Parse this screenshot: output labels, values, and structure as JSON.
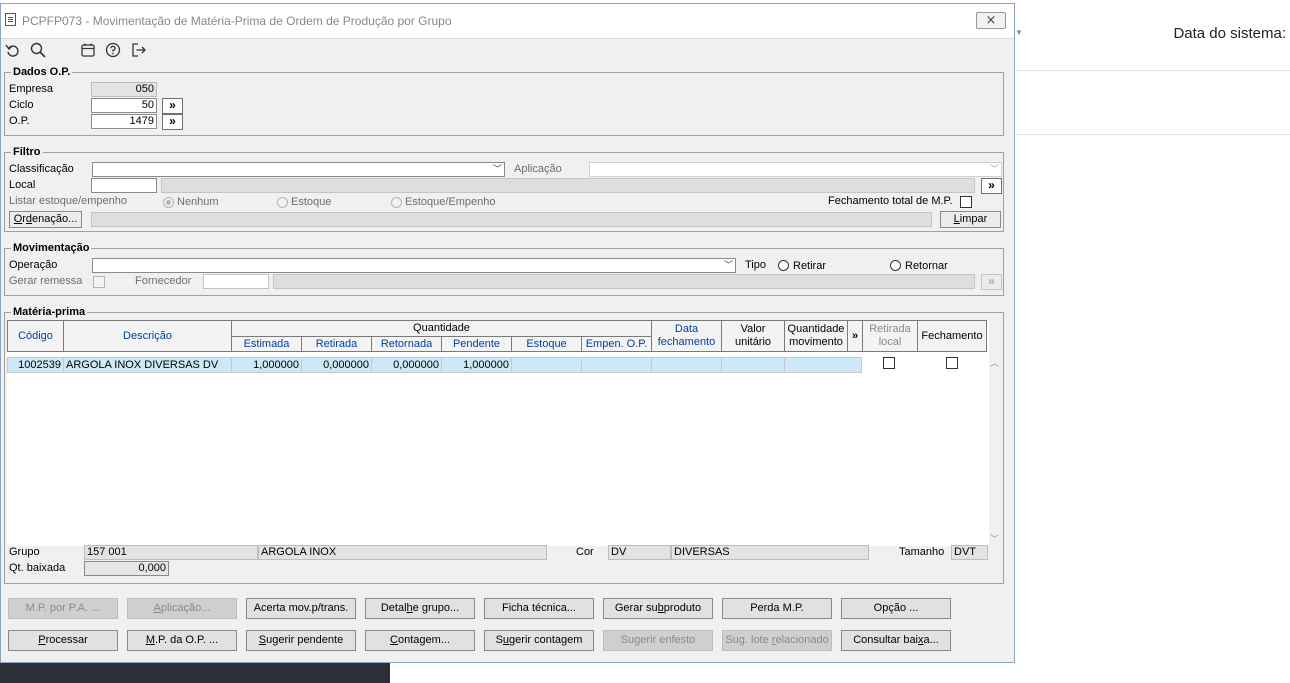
{
  "window": {
    "title": "PCPFP073 - Movimentação de Matéria-Prima de Ordem de Produção por Grupo",
    "close_glyph": "⨯"
  },
  "background": {
    "system_date_label": "Data do sistema:"
  },
  "toolbar": {
    "icons": [
      "undo-icon",
      "search-icon",
      "calendar-icon",
      "help-icon",
      "exit-icon"
    ]
  },
  "dados_op": {
    "legend": "Dados O.P.",
    "empresa_label": "Empresa",
    "empresa_value": "050",
    "ciclo_label": "Ciclo",
    "ciclo_value": "50",
    "op_label": "O.P.",
    "op_value": "1479",
    "lookup_glyph": "»"
  },
  "filtro": {
    "legend": "Filtro",
    "classificacao_label": "Classificação",
    "classificacao_value": "",
    "aplicacao_label": "Aplicação",
    "aplicacao_value": "",
    "local_label": "Local",
    "local_value": "",
    "listar_label": "Listar estoque/empenho",
    "radio_nenhum": "Nenhum",
    "radio_estoque": "Estoque",
    "radio_estoque_empenho": "Estoque/Empenho",
    "selected_listar": "Nenhum",
    "fechamento_total_label": "Fechamento total de M.P.",
    "ordenacao_button": "Ordenação...",
    "limpar_button": "Limpar"
  },
  "movimentacao": {
    "legend": "Movimentação",
    "operacao_label": "Operação",
    "operacao_value": "",
    "tipo_label": "Tipo",
    "radio_retirar": "Retirar",
    "radio_retornar": "Retornar",
    "gerar_remessa_label": "Gerar remessa",
    "fornecedor_label": "Fornecedor",
    "fornecedor_value": ""
  },
  "materia_prima": {
    "legend": "Matéria-prima",
    "headers": {
      "codigo": "Código",
      "descricao": "Descrição",
      "quantidade": "Quantidade",
      "estimada": "Estimada",
      "retirada": "Retirada",
      "retornada": "Retornada",
      "pendente": "Pendente",
      "estoque": "Estoque",
      "empen_op": "Empen. O.P.",
      "data_fechamento": "Data fechamento",
      "valor_unitario": "Valor unitário",
      "quantidade_movimento": "Quantidade movimento",
      "more": "»",
      "retirada_local": "Retirada local",
      "fechamento": "Fechamento"
    },
    "rows": [
      {
        "codigo": "1002539",
        "descricao": "ARGOLA INOX DIVERSAS DV",
        "estimada": "1,000000",
        "retirada": "0,000000",
        "retornada": "0,000000",
        "pendente": "1,000000",
        "estoque": "",
        "empen_op": "",
        "data_fechamento": "",
        "valor_unitario": "",
        "quantidade_movimento": ""
      }
    ],
    "grupo_label": "Grupo",
    "grupo_code": "157 001",
    "grupo_desc": "ARGOLA INOX",
    "cor_label": "Cor",
    "cor_code": "DV",
    "cor_desc": "DIVERSAS",
    "tamanho_label": "Tamanho",
    "tamanho_value": "DVT",
    "qt_baixada_label": "Qt. baixada",
    "qt_baixada_value": "0,000"
  },
  "buttons_row1": {
    "mp_por_pa": "M.P. por P.A. ...",
    "aplicacao": "Aplicação...",
    "acerta_mov": "Acerta mov.p/trans.",
    "detalhe_grupo": "Detalhe grupo...",
    "ficha_tecnica": "Ficha técnica...",
    "gerar_subproduto": "Gerar subproduto",
    "perda_mp": "Perda M.P.",
    "opcao": "Opção ..."
  },
  "buttons_row2": {
    "processar": "Processar",
    "mp_da_op": "M.P. da O.P. ...",
    "sugerir_pendente": "Sugerir pendente",
    "contagem": "Contagem...",
    "sugerir_contagem": "Sugerir contagem",
    "sugerir_enfesto": "Sugerir enfesto",
    "sug_lote": "Sug. lote relacionado",
    "consultar_baixa": "Consultar baixa..."
  }
}
